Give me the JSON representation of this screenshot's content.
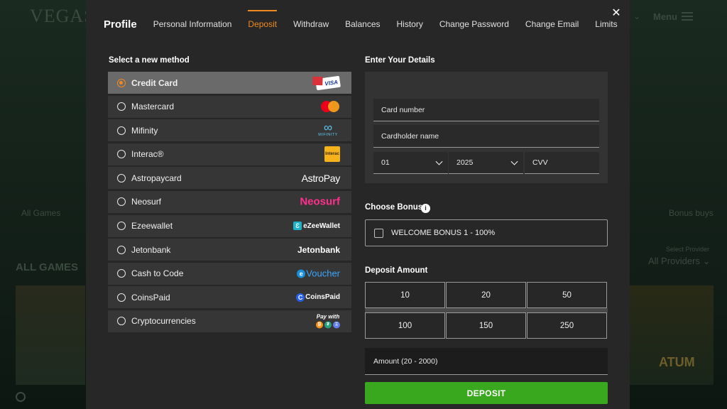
{
  "background": {
    "logo": "VEGAS",
    "menu_label": "Menu",
    "games_count": "All Games",
    "bonus_buys": "Bonus buys",
    "all_games": "ALL GAMES",
    "select_provider": "Select Provider",
    "all_providers": "All Providers ⌄",
    "tile_text": "ATUM"
  },
  "modal": {
    "close_symbol": "✕",
    "title": "Profile",
    "tabs": [
      {
        "label": "Personal Information",
        "active": false
      },
      {
        "label": "Deposit",
        "active": true
      },
      {
        "label": "Withdraw",
        "active": false
      },
      {
        "label": "Balances",
        "active": false
      },
      {
        "label": "History",
        "active": false
      },
      {
        "label": "Change Password",
        "active": false
      },
      {
        "label": "Change Email",
        "active": false
      },
      {
        "label": "Limits",
        "active": false
      }
    ]
  },
  "methods": {
    "heading": "Select a new method",
    "selected_index": 0,
    "items": [
      {
        "label": "Credit Card",
        "logo": "visa-icon",
        "logo_text": "VISA"
      },
      {
        "label": "Mastercard",
        "logo": "mastercard-icon"
      },
      {
        "label": "Mifinity",
        "logo": "mifinity-icon",
        "logo_text": "MIFINITY"
      },
      {
        "label": "Interac®",
        "logo": "interac-icon",
        "logo_text": "Interac"
      },
      {
        "label": "Astropaycard",
        "logo": "astropay-icon",
        "logo_text": "AstroPay"
      },
      {
        "label": "Neosurf",
        "logo": "neosurf-icon",
        "logo_text": "Neosurf"
      },
      {
        "label": "Ezeewallet",
        "logo": "ezeewallet-icon",
        "logo_text": "eZeeWallet"
      },
      {
        "label": "Jetonbank",
        "logo": "jetonbank-icon",
        "logo_text": "Jetonbank"
      },
      {
        "label": "Cash to Code",
        "logo": "evoucher-icon",
        "logo_text": "Voucher"
      },
      {
        "label": "CoinsPaid",
        "logo": "coinspaid-icon",
        "logo_text": "CoinsPaid"
      },
      {
        "label": "Cryptocurrencies",
        "logo": "crypto-icon",
        "logo_text": "Pay with"
      }
    ]
  },
  "details": {
    "heading": "Enter Your Details",
    "card_number_placeholder": "Card number",
    "cardholder_placeholder": "Cardholder name",
    "month_value": "01",
    "year_value": "2025",
    "cvv_placeholder": "CVV"
  },
  "bonus": {
    "heading": "Choose Bonus",
    "info_symbol": "i",
    "option_label": "WELCOME BONUS 1 - 100%"
  },
  "deposit": {
    "heading": "Deposit Amount",
    "amounts": [
      "10",
      "20",
      "50",
      "100",
      "150",
      "250"
    ],
    "amount_placeholder": "Amount (20 - 2000)",
    "button_label": "DEPOSIT"
  },
  "colors": {
    "accent": "#f0891f",
    "deposit_green": "#3aa81e",
    "modal_bg": "#272727"
  }
}
